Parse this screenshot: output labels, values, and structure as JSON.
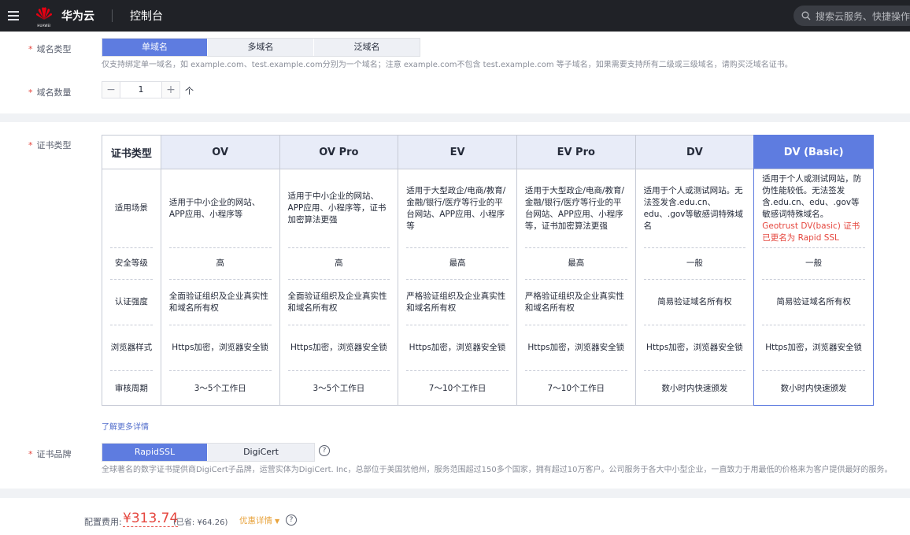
{
  "topbar": {
    "logo_text": "HUAWEI",
    "brand": "华为云",
    "console": "控制台",
    "search_placeholder": "搜索云服务、快捷操作"
  },
  "domain_type": {
    "label": "域名类型",
    "options": [
      "单域名",
      "多域名",
      "泛域名"
    ],
    "selected": "单域名",
    "hint": "仅支持绑定单一域名，如 example.com、test.example.com分别为一个域名；注意 example.com不包含 test.example.com 等子域名，如果需要支持所有二级或三级域名，请购买泛域名证书。"
  },
  "domain_count": {
    "label": "域名数量",
    "minus": "−",
    "value": "1",
    "plus": "+",
    "unit": "个"
  },
  "cert_type": {
    "label": "证书类型",
    "table": {
      "header": "证书类型",
      "row_labels": [
        "适用场景",
        "安全等级",
        "认证强度",
        "浏览器样式",
        "审核周期"
      ],
      "columns": [
        {
          "name": "OV",
          "scenario": "适用于中小企业的网站、APP应用、小程序等",
          "security": "高",
          "strength": "全面验证组织及企业真实性和域名所有权",
          "browser": "Https加密，浏览器安全锁",
          "period": "3～5个工作日"
        },
        {
          "name": "OV Pro",
          "scenario": "适用于中小企业的网站、APP应用、小程序等，证书加密算法更强",
          "security": "高",
          "strength": "全面验证组织及企业真实性和域名所有权",
          "browser": "Https加密，浏览器安全锁",
          "period": "3～5个工作日"
        },
        {
          "name": "EV",
          "scenario": "适用于大型政企/电商/教育/金融/银行/医疗等行业的平台网站、APP应用、小程序等",
          "security": "最高",
          "strength": "严格验证组织及企业真实性和域名所有权",
          "browser": "Https加密，浏览器安全锁",
          "period": "7～10个工作日"
        },
        {
          "name": "EV Pro",
          "scenario": "适用于大型政企/电商/教育/金融/银行/医疗等行业的平台网站、APP应用、小程序等，证书加密算法更强",
          "security": "最高",
          "strength": "严格验证组织及企业真实性和域名所有权",
          "browser": "Https加密，浏览器安全锁",
          "period": "7～10个工作日"
        },
        {
          "name": "DV",
          "scenario": "适用于个人或测试网站。无法签发含.edu.cn、edu、.gov等敏感词特殊域名",
          "security": "一般",
          "strength": "简易验证域名所有权",
          "browser": "Https加密，浏览器安全锁",
          "period": "数小时内快速颁发"
        },
        {
          "name": "DV (Basic)",
          "scenario": "适用于个人或测试网站，防伪性能较低。无法签发含.edu.cn、edu、.gov等敏感词特殊域名。",
          "scenario_note": "Geotrust DV(basic) 证书已更名为 Rapid SSL",
          "security": "一般",
          "strength": "简易验证域名所有权",
          "browser": "Https加密，浏览器安全锁",
          "period": "数小时内快速颁发"
        }
      ],
      "selected": "DV (Basic)"
    },
    "more_link": "了解更多详情"
  },
  "cert_brand": {
    "label": "证书品牌",
    "options": [
      "RapidSSL",
      "DigiCert"
    ],
    "selected": "RapidSSL",
    "help": "?",
    "hint": "全球著名的数字证书提供商DigiCert子品牌，运营实体为DigiCert. Inc，总部位于美国犹他州，服务范围超过150多个国家，拥有超过10万客户。公司服务于各大中小型企业，一直致力于用最低的价格来为客户提供最好的服务。"
  },
  "fee": {
    "label": "配置费用:",
    "value": "¥313.74",
    "saved": "(已省: ¥64.26)",
    "promo": "优惠详情",
    "help": "?"
  },
  "colors": {
    "primary": "#5e7ce0",
    "danger": "#e5473f",
    "topbar": "#202227",
    "warning": "#e8a33c"
  }
}
